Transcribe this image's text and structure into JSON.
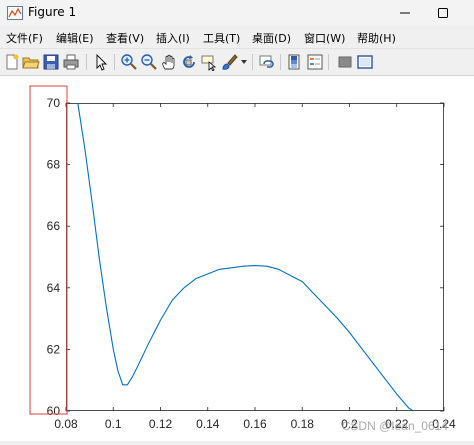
{
  "window": {
    "title": "Figure 1"
  },
  "menu": [
    {
      "label": "文件(F)"
    },
    {
      "label": "编辑(E)"
    },
    {
      "label": "查看(V)"
    },
    {
      "label": "插入(I)"
    },
    {
      "label": "工具(T)"
    },
    {
      "label": "桌面(D)"
    },
    {
      "label": "窗口(W)"
    },
    {
      "label": "帮助(H)"
    }
  ],
  "toolbar": {
    "icons": [
      "new-figure-icon",
      "open-file-icon",
      "save-icon",
      "print-icon",
      "pointer-icon",
      "zoom-in-icon",
      "zoom-out-icon",
      "pan-hand-icon",
      "rotate-3d-icon",
      "data-cursor-icon",
      "brush-icon",
      "link-plot-icon",
      "colorbar-icon",
      "legend-icon",
      "hide-plot-tools-icon",
      "show-plot-tools-icon"
    ]
  },
  "colors": {
    "line": "#0072bd",
    "highlight": "#e0403a"
  },
  "watermark": "CSDN @Iean_0614",
  "chart_data": {
    "type": "line",
    "xlim": [
      0.08,
      0.24
    ],
    "ylim": [
      60,
      70
    ],
    "xticks": [
      "0.08",
      "0.1",
      "0.12",
      "0.14",
      "0.16",
      "0.18",
      "0.2",
      "0.22",
      "0.24"
    ],
    "yticks": [
      "60",
      "62",
      "64",
      "66",
      "68",
      "70"
    ],
    "grid": false,
    "series": [
      {
        "points": [
          [
            0.085,
            70.0
          ],
          [
            0.088,
            68.5
          ],
          [
            0.091,
            66.8
          ],
          [
            0.094,
            65.0
          ],
          [
            0.097,
            63.4
          ],
          [
            0.1,
            62.0
          ],
          [
            0.102,
            61.3
          ],
          [
            0.104,
            60.85
          ],
          [
            0.106,
            60.85
          ],
          [
            0.108,
            61.1
          ],
          [
            0.11,
            61.4
          ],
          [
            0.115,
            62.2
          ],
          [
            0.12,
            62.95
          ],
          [
            0.125,
            63.6
          ],
          [
            0.13,
            64.0
          ],
          [
            0.135,
            64.3
          ],
          [
            0.14,
            64.45
          ],
          [
            0.145,
            64.6
          ],
          [
            0.15,
            64.65
          ],
          [
            0.155,
            64.7
          ],
          [
            0.16,
            64.72
          ],
          [
            0.165,
            64.7
          ],
          [
            0.17,
            64.6
          ],
          [
            0.175,
            64.4
          ],
          [
            0.18,
            64.2
          ],
          [
            0.185,
            63.8
          ],
          [
            0.19,
            63.4
          ],
          [
            0.195,
            63.0
          ],
          [
            0.2,
            62.55
          ],
          [
            0.205,
            62.05
          ],
          [
            0.21,
            61.55
          ],
          [
            0.215,
            61.05
          ],
          [
            0.22,
            60.55
          ],
          [
            0.225,
            60.1
          ],
          [
            0.227,
            60.0
          ]
        ]
      }
    ]
  }
}
